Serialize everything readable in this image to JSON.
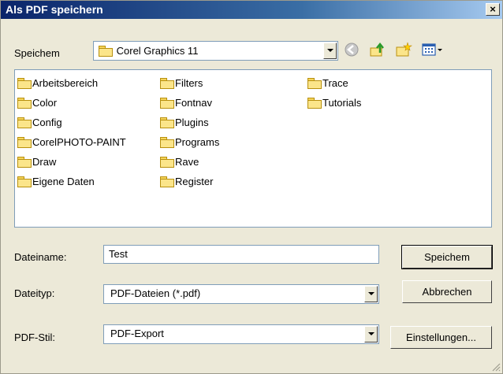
{
  "window": {
    "title": "Als PDF speichern",
    "close_glyph": "×"
  },
  "save_in": {
    "label": "Speichem",
    "value": "Corel Graphics 11"
  },
  "toolbar": {
    "icons": [
      "back-icon",
      "up-folder-icon",
      "new-folder-icon",
      "view-menu-icon"
    ]
  },
  "files": [
    [
      "Arbeitsbereich",
      "Color",
      "Config",
      "CorelPHOTO-PAINT",
      "Draw",
      "Eigene Daten"
    ],
    [
      "Filters",
      "Fontnav",
      "Plugins",
      "Programs",
      "Rave",
      "Register"
    ],
    [
      "Trace",
      "Tutorials"
    ]
  ],
  "filename": {
    "label": "Dateiname:",
    "value": "Test"
  },
  "filetype": {
    "label": "Dateityp:",
    "value": "PDF-Dateien (*.pdf)"
  },
  "pdfstyle": {
    "label": "PDF-Stil:",
    "value": "PDF-Export"
  },
  "buttons": {
    "save": "Speichem",
    "cancel": "Abbrechen",
    "settings": "Einstellungen..."
  },
  "colors": {
    "title_start": "#0a246a",
    "title_end": "#a6caf0",
    "dialog_bg": "#ece9d8",
    "folder": "#fbe58a"
  }
}
